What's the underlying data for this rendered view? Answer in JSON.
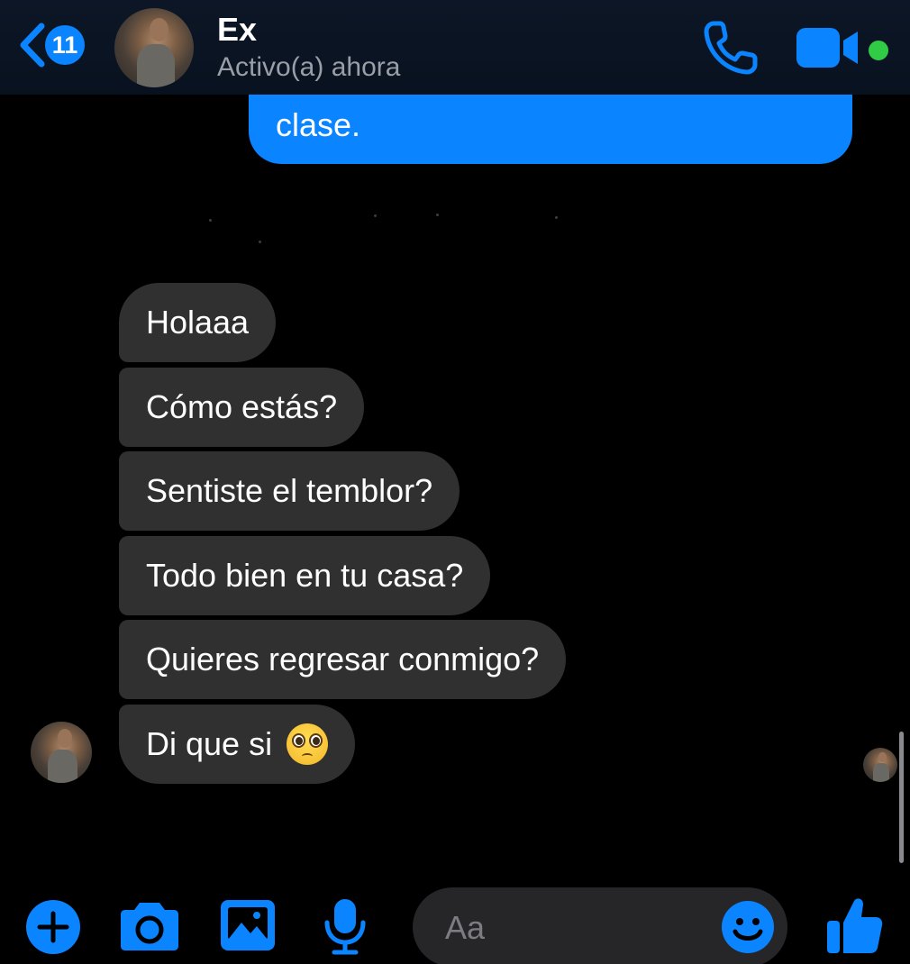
{
  "header": {
    "back_count": "11",
    "contact_name": "Ex",
    "contact_status": "Activo(a) ahora"
  },
  "messages": {
    "sent_partial": "clase.",
    "received": [
      "Holaaa",
      "Cómo estás?",
      "Sentiste el temblor?",
      "Todo bien en tu casa?",
      "Quieres regresar conmigo?",
      "Di que si"
    ],
    "last_emoji": "pleading-face"
  },
  "composer": {
    "placeholder": "Aa"
  },
  "colors": {
    "accent": "#0a84ff",
    "received_bubble": "#303030",
    "online": "#31cc46",
    "background": "#000000"
  },
  "icons": [
    "back-chevron-icon",
    "phone-icon",
    "video-camera-icon",
    "plus-icon",
    "camera-icon",
    "photo-icon",
    "microphone-icon",
    "emoji-icon",
    "thumbs-up-icon"
  ]
}
